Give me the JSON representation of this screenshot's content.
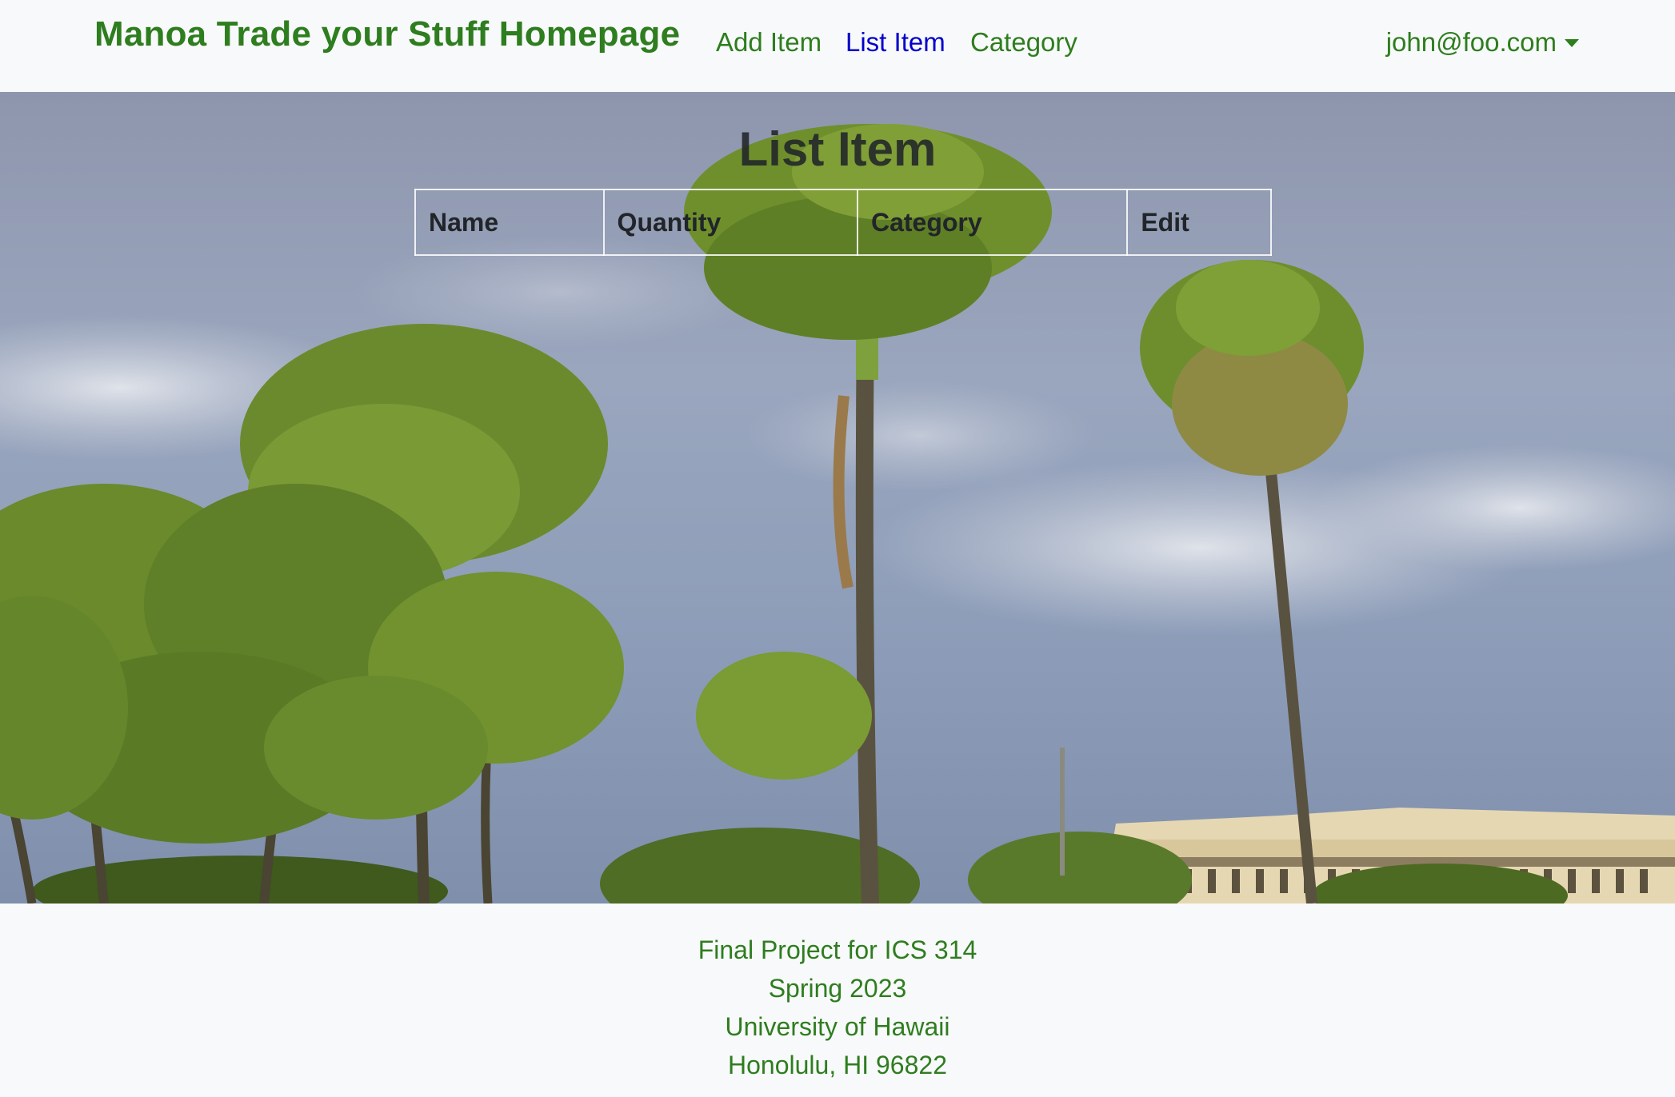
{
  "navbar": {
    "brand": "Manoa Trade your Stuff Homepage",
    "links": [
      {
        "label": "Add Item",
        "active": false
      },
      {
        "label": "List Item",
        "active": true
      },
      {
        "label": "Category",
        "active": false
      }
    ],
    "user": "john@foo.com",
    "user_icon": "chevron-down-icon"
  },
  "main": {
    "title": "List Item",
    "table": {
      "headers": [
        "Name",
        "Quantity",
        "Category",
        "Edit"
      ],
      "rows": []
    },
    "background": "palm-trees-campus-photo"
  },
  "footer": {
    "lines": [
      "Final Project for ICS 314",
      "Spring 2023",
      "University of Hawaii",
      "Honolulu, HI 96822"
    ]
  },
  "colors": {
    "brand_green": "#2e7d1f",
    "active_link": "#0000cc",
    "navbar_bg": "#f8f9fa",
    "heading_text": "#212529"
  }
}
